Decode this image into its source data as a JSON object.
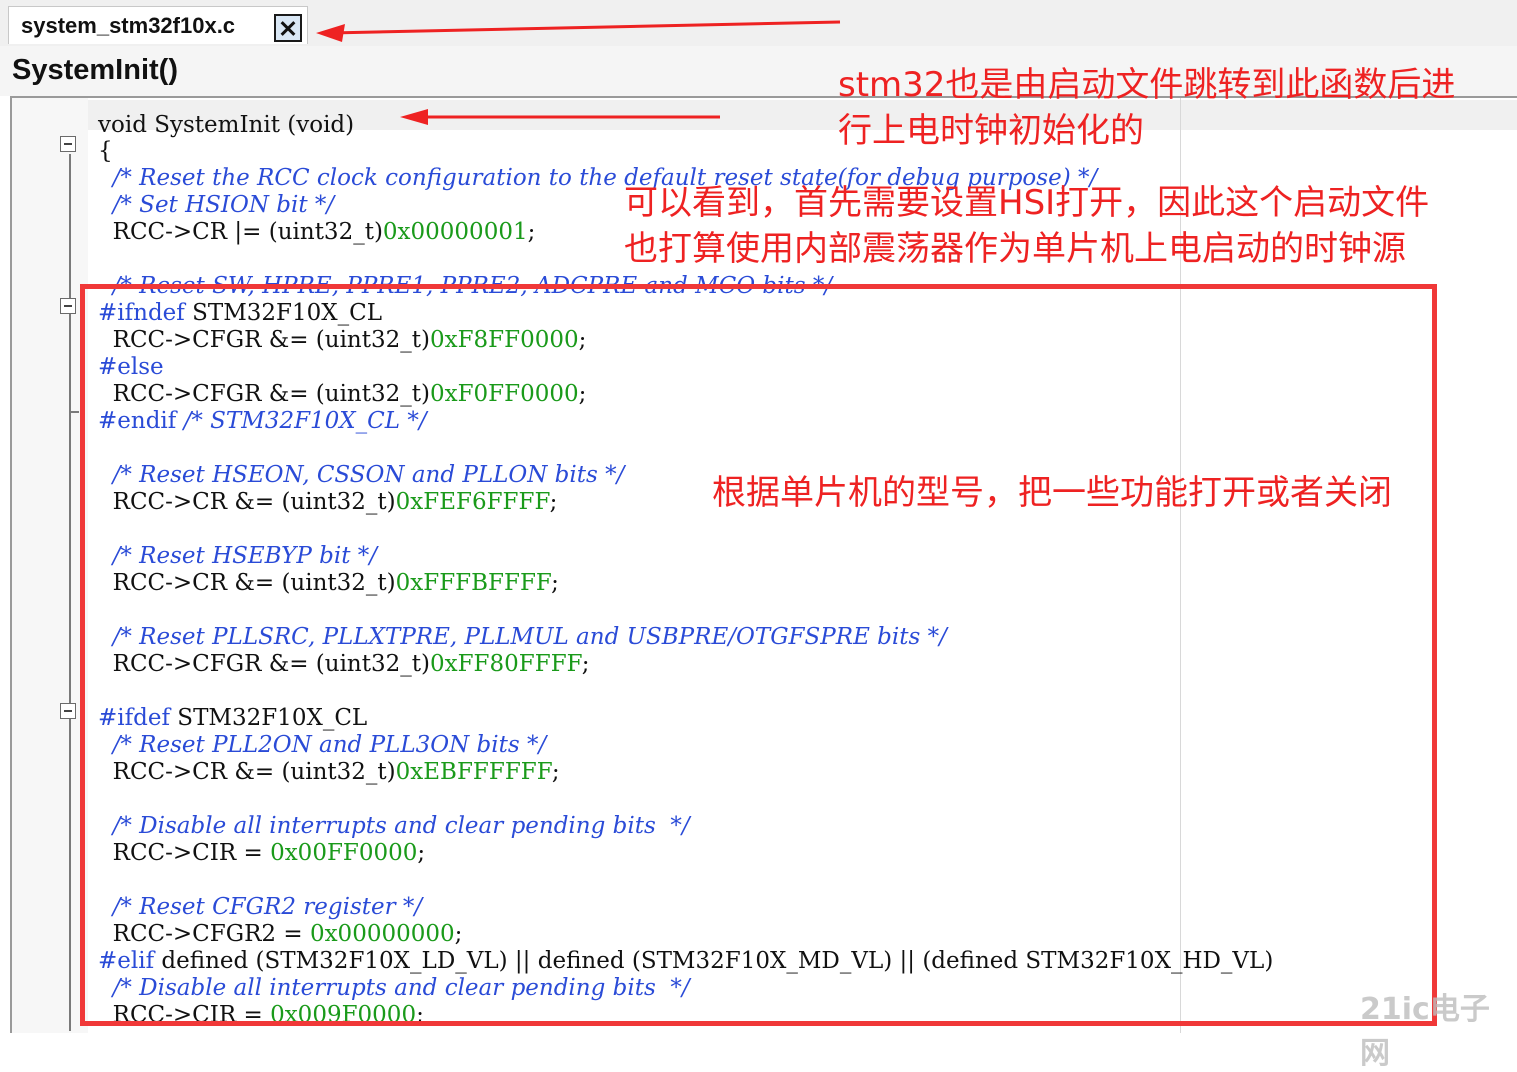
{
  "tab": {
    "filename": "system_stm32f10x.c"
  },
  "function_header": {
    "name": "SystemInit()"
  },
  "code_lines": [
    [
      {
        "t": "kw",
        "v": "void SystemInit (void)"
      }
    ],
    [
      {
        "t": "kw",
        "v": "{"
      }
    ],
    [
      {
        "t": "c",
        "v": "  /* Reset the RCC clock configuration to the default reset state(for debug purpose) */"
      }
    ],
    [
      {
        "t": "c",
        "v": "  /* Set HSION bit */"
      }
    ],
    [
      {
        "t": "kw",
        "v": "  RCC->CR |= (uint32_t)"
      },
      {
        "t": "nm",
        "v": "0x00000001"
      },
      {
        "t": "kw",
        "v": ";"
      }
    ],
    [
      {
        "t": "kw",
        "v": ""
      }
    ],
    [
      {
        "t": "c",
        "v": "  /* Reset SW, HPRE, PPRE1, PPRE2, ADCPRE and MCO bits */"
      }
    ],
    [
      {
        "t": "pp",
        "v": "#ifndef"
      },
      {
        "t": "kw",
        "v": " STM32F10X_CL"
      }
    ],
    [
      {
        "t": "kw",
        "v": "  RCC->CFGR &= (uint32_t)"
      },
      {
        "t": "nm",
        "v": "0xF8FF0000"
      },
      {
        "t": "kw",
        "v": ";"
      }
    ],
    [
      {
        "t": "pp",
        "v": "#else"
      }
    ],
    [
      {
        "t": "kw",
        "v": "  RCC->CFGR &= (uint32_t)"
      },
      {
        "t": "nm",
        "v": "0xF0FF0000"
      },
      {
        "t": "kw",
        "v": ";"
      }
    ],
    [
      {
        "t": "pp",
        "v": "#endif"
      },
      {
        "t": "c",
        "v": " /* STM32F10X_CL */"
      }
    ],
    [
      {
        "t": "kw",
        "v": ""
      }
    ],
    [
      {
        "t": "c",
        "v": "  /* Reset HSEON, CSSON and PLLON bits */"
      }
    ],
    [
      {
        "t": "kw",
        "v": "  RCC->CR &= (uint32_t)"
      },
      {
        "t": "nm",
        "v": "0xFEF6FFFF"
      },
      {
        "t": "kw",
        "v": ";"
      }
    ],
    [
      {
        "t": "kw",
        "v": ""
      }
    ],
    [
      {
        "t": "c",
        "v": "  /* Reset HSEBYP bit */"
      }
    ],
    [
      {
        "t": "kw",
        "v": "  RCC->CR &= (uint32_t)"
      },
      {
        "t": "nm",
        "v": "0xFFFBFFFF"
      },
      {
        "t": "kw",
        "v": ";"
      }
    ],
    [
      {
        "t": "kw",
        "v": ""
      }
    ],
    [
      {
        "t": "c",
        "v": "  /* Reset PLLSRC, PLLXTPRE, PLLMUL and USBPRE/OTGFSPRE bits */"
      }
    ],
    [
      {
        "t": "kw",
        "v": "  RCC->CFGR &= (uint32_t)"
      },
      {
        "t": "nm",
        "v": "0xFF80FFFF"
      },
      {
        "t": "kw",
        "v": ";"
      }
    ],
    [
      {
        "t": "kw",
        "v": ""
      }
    ],
    [
      {
        "t": "pp",
        "v": "#ifdef"
      },
      {
        "t": "kw",
        "v": " STM32F10X_CL"
      }
    ],
    [
      {
        "t": "c",
        "v": "  /* Reset PLL2ON and PLL3ON bits */"
      }
    ],
    [
      {
        "t": "kw",
        "v": "  RCC->CR &= (uint32_t)"
      },
      {
        "t": "nm",
        "v": "0xEBFFFFFF"
      },
      {
        "t": "kw",
        "v": ";"
      }
    ],
    [
      {
        "t": "kw",
        "v": ""
      }
    ],
    [
      {
        "t": "c",
        "v": "  /* Disable all interrupts and clear pending bits  */"
      }
    ],
    [
      {
        "t": "kw",
        "v": "  RCC->CIR = "
      },
      {
        "t": "nm",
        "v": "0x00FF0000"
      },
      {
        "t": "kw",
        "v": ";"
      }
    ],
    [
      {
        "t": "kw",
        "v": ""
      }
    ],
    [
      {
        "t": "c",
        "v": "  /* Reset CFGR2 register */"
      }
    ],
    [
      {
        "t": "kw",
        "v": "  RCC->CFGR2 = "
      },
      {
        "t": "nm",
        "v": "0x00000000"
      },
      {
        "t": "kw",
        "v": ";"
      }
    ],
    [
      {
        "t": "pp",
        "v": "#elif"
      },
      {
        "t": "kw",
        "v": " defined (STM32F10X_LD_VL) || defined (STM32F10X_MD_VL) || (defined STM32F10X_HD_VL)"
      }
    ],
    [
      {
        "t": "c",
        "v": "  /* Disable all interrupts and clear pending bits  */"
      }
    ],
    [
      {
        "t": "kw",
        "v": "  RCC->CIR = "
      },
      {
        "t": "nm",
        "v": "0x009F0000"
      },
      {
        "t": "kw",
        "v": ";"
      }
    ]
  ],
  "annotations": {
    "note1_line1": "stm32也是由启动文件跳转到此函数后进",
    "note1_line2": "行上电时钟初始化的",
    "note2_line1": "可以看到，首先需要设置HSI打开，因此这个启动文件",
    "note2_line2": "也打算使用内部震荡器作为单片机上电启动的时钟源",
    "note3": "根据单片机的型号，把一些功能打开或者关闭"
  },
  "colors": {
    "comment": "#2a4bd7",
    "number": "#1a9a1a",
    "annotation": "#ee2222"
  },
  "watermark": "21ic电子网"
}
